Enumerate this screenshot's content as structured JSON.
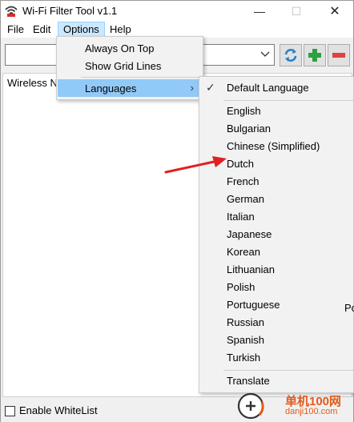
{
  "window": {
    "title": "Wi-Fi Filter Tool v1.1",
    "controls": {
      "minimize": "—",
      "maximize": "☐",
      "close": "✕"
    }
  },
  "menubar": {
    "items": [
      "File",
      "Edit",
      "Options",
      "Help"
    ]
  },
  "toolbar": {
    "combo_value": "",
    "refresh_icon": "refresh-icon",
    "add_icon": "plus-icon",
    "remove_icon": "minus-icon"
  },
  "content": {
    "column_header": "Wireless N"
  },
  "options_menu": {
    "items": [
      "Always On Top",
      "Show Grid Lines",
      "Languages"
    ],
    "submenu_chevron": "›"
  },
  "languages_menu": {
    "checked": "Default Language",
    "check_glyph": "✓",
    "items": [
      "English",
      "Bulgarian",
      "Chinese (Simplified)",
      "Dutch",
      "French",
      "German",
      "Italian",
      "Japanese",
      "Korean",
      "Lithuanian",
      "Polish",
      "Portuguese",
      "Russian",
      "Spanish",
      "Turkish"
    ],
    "clipped_text": "Po",
    "translate": "Translate"
  },
  "statusbar": {
    "whitelist_label": "Enable WhiteList"
  },
  "watermark": {
    "brand": "单机100网",
    "domain": "danji100.com"
  },
  "colors": {
    "menu_highlight": "#91c9f7",
    "menubar_active": "#cce8ff",
    "add_green": "#2ea043",
    "remove_red": "#e04040",
    "annotation_arrow": "#e02020"
  }
}
